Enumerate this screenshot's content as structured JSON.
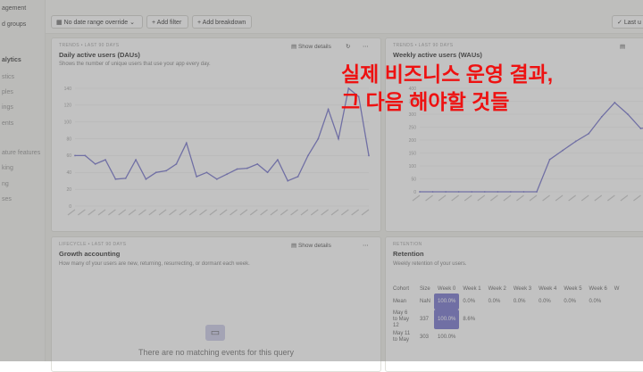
{
  "sidebar": {
    "items": [
      "agement",
      "d groups",
      "alytics",
      "stics",
      "ples",
      "ings",
      "ents",
      "ature features",
      "king",
      "ng",
      "ses"
    ]
  },
  "toolbar": {
    "date_range": "No date range override",
    "add_filter": "Add filter",
    "add_breakdown": "Add breakdown",
    "last_updated": "Last u"
  },
  "cards": {
    "dau": {
      "eyebrow": "TRENDS • LAST 90 DAYS",
      "title": "Daily active users (DAUs)",
      "desc": "Shows the number of unique users that use your app every day.",
      "show_details": "Show details"
    },
    "wau": {
      "eyebrow": "TRENDS • LAST 90 DAYS",
      "title": "Weekly active users (WAUs)",
      "show_details": "Show details"
    },
    "growth": {
      "eyebrow": "LIFECYCLE • LAST 90 DAYS",
      "title": "Growth accounting",
      "desc": "How many of your users are new, returning, resurrecting, or dormant each week.",
      "show_details": "Show details",
      "empty": "There are no matching events for this query"
    },
    "retention": {
      "eyebrow": "RETENTION",
      "title": "Retention",
      "desc": "Weekly retention of your users.",
      "headers": [
        "Cohort",
        "Size",
        "Week 0",
        "Week 1",
        "Week 2",
        "Week 3",
        "Week 4",
        "Week 5",
        "Week 6",
        "W"
      ],
      "rows": [
        {
          "cohort": "Mean",
          "size": "NaN",
          "cells": [
            "100.0%",
            "0.0%",
            "0.0%",
            "0.0%",
            "0.0%",
            "0.0%",
            "0.0%"
          ]
        },
        {
          "cohort": "May 6 to May 12",
          "size": "337",
          "cells": [
            "100.0%",
            "8.6%"
          ]
        },
        {
          "cohort": "May 11 to May",
          "size": "303",
          "cells": [
            "100.0%"
          ]
        }
      ]
    }
  },
  "overlay_text": [
    "실제 비즈니스 운영 결과,",
    "그 다음 해야할 것들"
  ],
  "colors": {
    "line": "#6b69c9",
    "accent_red": "#ee1111"
  },
  "chart_data": [
    {
      "type": "line",
      "title": "Daily active users (DAUs)",
      "yticks": [
        0,
        20,
        40,
        60,
        80,
        100,
        120,
        140
      ],
      "ylim": [
        0,
        140
      ],
      "values": [
        60,
        60,
        50,
        55,
        32,
        33,
        55,
        32,
        40,
        42,
        50,
        75,
        35,
        40,
        32,
        38,
        44,
        45,
        50,
        40,
        55,
        30,
        35,
        60,
        80,
        115,
        80,
        140,
        130,
        60
      ]
    },
    {
      "type": "line",
      "title": "Weekly active users (WAUs)",
      "yticks": [
        0,
        50,
        100,
        150,
        200,
        250,
        300,
        350,
        400
      ],
      "ylim": [
        0,
        400
      ],
      "values": [
        0,
        0,
        0,
        0,
        0,
        0,
        0,
        0,
        0,
        0,
        125,
        160,
        195,
        225,
        290,
        345,
        300,
        245,
        250
      ]
    }
  ]
}
